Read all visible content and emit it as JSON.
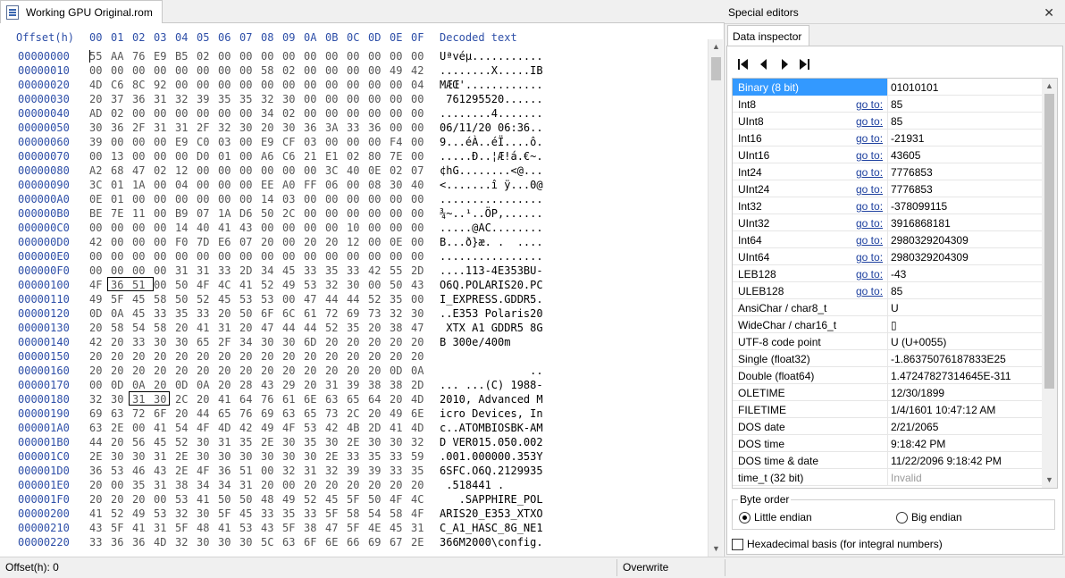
{
  "tab": {
    "filename": "Working GPU Original.rom"
  },
  "hex_header": {
    "offset_label": "Offset(h)",
    "columns": [
      "00",
      "01",
      "02",
      "03",
      "04",
      "05",
      "06",
      "07",
      "08",
      "09",
      "0A",
      "0B",
      "0C",
      "0D",
      "0E",
      "0F"
    ],
    "decoded_label": "Decoded text"
  },
  "rows": [
    {
      "offset": "00000000",
      "bytes": [
        "55",
        "AA",
        "76",
        "E9",
        "B5",
        "02",
        "00",
        "00",
        "00",
        "00",
        "00",
        "00",
        "00",
        "00",
        "00",
        "00"
      ],
      "text": "Uªvéµ..........."
    },
    {
      "offset": "00000010",
      "bytes": [
        "00",
        "00",
        "00",
        "00",
        "00",
        "00",
        "00",
        "00",
        "58",
        "02",
        "00",
        "00",
        "00",
        "00",
        "49",
        "42"
      ],
      "text": "........X.....IB"
    },
    {
      "offset": "00000020",
      "bytes": [
        "4D",
        "C6",
        "8C",
        "92",
        "00",
        "00",
        "00",
        "00",
        "00",
        "00",
        "00",
        "00",
        "00",
        "00",
        "00",
        "04"
      ],
      "text": "MÆŒ'............"
    },
    {
      "offset": "00000030",
      "bytes": [
        "20",
        "37",
        "36",
        "31",
        "32",
        "39",
        "35",
        "35",
        "32",
        "30",
        "00",
        "00",
        "00",
        "00",
        "00",
        "00"
      ],
      "text": " 761295520......"
    },
    {
      "offset": "00000040",
      "bytes": [
        "AD",
        "02",
        "00",
        "00",
        "00",
        "00",
        "00",
        "00",
        "34",
        "02",
        "00",
        "00",
        "00",
        "00",
        "00",
        "00"
      ],
      "text": "........4......."
    },
    {
      "offset": "00000050",
      "bytes": [
        "30",
        "36",
        "2F",
        "31",
        "31",
        "2F",
        "32",
        "30",
        "20",
        "30",
        "36",
        "3A",
        "33",
        "36",
        "00",
        "00"
      ],
      "text": "06/11/20 06:36.."
    },
    {
      "offset": "00000060",
      "bytes": [
        "39",
        "00",
        "00",
        "00",
        "E9",
        "C0",
        "03",
        "00",
        "E9",
        "CF",
        "03",
        "00",
        "00",
        "00",
        "F4",
        "00"
      ],
      "text": "9...éÀ..éÏ....ô."
    },
    {
      "offset": "00000070",
      "bytes": [
        "00",
        "13",
        "00",
        "00",
        "00",
        "D0",
        "01",
        "00",
        "A6",
        "C6",
        "21",
        "E1",
        "02",
        "80",
        "7E",
        "00"
      ],
      "text": ".....Ð..¦Æ!á.€~."
    },
    {
      "offset": "00000080",
      "bytes": [
        "A2",
        "68",
        "47",
        "02",
        "12",
        "00",
        "00",
        "00",
        "00",
        "00",
        "00",
        "3C",
        "40",
        "0E",
        "02",
        "07"
      ],
      "text": "¢hG........<@..."
    },
    {
      "offset": "00000090",
      "bytes": [
        "3C",
        "01",
        "1A",
        "00",
        "04",
        "00",
        "00",
        "00",
        "EE",
        "A0",
        "FF",
        "06",
        "00",
        "08",
        "30",
        "40"
      ],
      "text": "<.......î ÿ...0@"
    },
    {
      "offset": "000000A0",
      "bytes": [
        "0E",
        "01",
        "00",
        "00",
        "00",
        "00",
        "00",
        "00",
        "14",
        "03",
        "00",
        "00",
        "00",
        "00",
        "00",
        "00"
      ],
      "text": "................"
    },
    {
      "offset": "000000B0",
      "bytes": [
        "BE",
        "7E",
        "11",
        "00",
        "B9",
        "07",
        "1A",
        "D6",
        "50",
        "2C",
        "00",
        "00",
        "00",
        "00",
        "00",
        "00"
      ],
      "text": "¾~..¹..ÖP,......"
    },
    {
      "offset": "000000C0",
      "bytes": [
        "00",
        "00",
        "00",
        "00",
        "14",
        "40",
        "41",
        "43",
        "00",
        "00",
        "00",
        "00",
        "10",
        "00",
        "00",
        "00"
      ],
      "text": ".....@AC........"
    },
    {
      "offset": "000000D0",
      "bytes": [
        "42",
        "00",
        "00",
        "00",
        "F0",
        "7D",
        "E6",
        "07",
        "20",
        "00",
        "20",
        "20",
        "12",
        "00",
        "0E",
        "00"
      ],
      "text": "B...ð}æ. .  ...."
    },
    {
      "offset": "000000E0",
      "bytes": [
        "00",
        "00",
        "00",
        "00",
        "00",
        "00",
        "00",
        "00",
        "00",
        "00",
        "00",
        "00",
        "00",
        "00",
        "00",
        "00"
      ],
      "text": "................"
    },
    {
      "offset": "000000F0",
      "bytes": [
        "00",
        "00",
        "00",
        "00",
        "31",
        "31",
        "33",
        "2D",
        "34",
        "45",
        "33",
        "35",
        "33",
        "42",
        "55",
        "2D"
      ],
      "text": "....113-4E353BU-"
    },
    {
      "offset": "00000100",
      "bytes": [
        "4F",
        "36",
        "51",
        "00",
        "50",
        "4F",
        "4C",
        "41",
        "52",
        "49",
        "53",
        "32",
        "30",
        "00",
        "50",
        "43"
      ],
      "text": "O6Q.POLARIS20.PC"
    },
    {
      "offset": "00000110",
      "bytes": [
        "49",
        "5F",
        "45",
        "58",
        "50",
        "52",
        "45",
        "53",
        "53",
        "00",
        "47",
        "44",
        "44",
        "52",
        "35",
        "00"
      ],
      "text": "I_EXPRESS.GDDR5."
    },
    {
      "offset": "00000120",
      "bytes": [
        "0D",
        "0A",
        "45",
        "33",
        "35",
        "33",
        "20",
        "50",
        "6F",
        "6C",
        "61",
        "72",
        "69",
        "73",
        "32",
        "30"
      ],
      "text": "..E353 Polaris20"
    },
    {
      "offset": "00000130",
      "bytes": [
        "20",
        "58",
        "54",
        "58",
        "20",
        "41",
        "31",
        "20",
        "47",
        "44",
        "44",
        "52",
        "35",
        "20",
        "38",
        "47"
      ],
      "text": " XTX A1 GDDR5 8G"
    },
    {
      "offset": "00000140",
      "bytes": [
        "42",
        "20",
        "33",
        "30",
        "30",
        "65",
        "2F",
        "34",
        "30",
        "30",
        "6D",
        "20",
        "20",
        "20",
        "20",
        "20"
      ],
      "text": "B 300e/400m     "
    },
    {
      "offset": "00000150",
      "bytes": [
        "20",
        "20",
        "20",
        "20",
        "20",
        "20",
        "20",
        "20",
        "20",
        "20",
        "20",
        "20",
        "20",
        "20",
        "20",
        "20"
      ],
      "text": "                "
    },
    {
      "offset": "00000160",
      "bytes": [
        "20",
        "20",
        "20",
        "20",
        "20",
        "20",
        "20",
        "20",
        "20",
        "20",
        "20",
        "20",
        "20",
        "20",
        "0D",
        "0A"
      ],
      "text": "              .."
    },
    {
      "offset": "00000170",
      "bytes": [
        "00",
        "0D",
        "0A",
        "20",
        "0D",
        "0A",
        "20",
        "28",
        "43",
        "29",
        "20",
        "31",
        "39",
        "38",
        "38",
        "2D"
      ],
      "text": "... ...(C) 1988-"
    },
    {
      "offset": "00000180",
      "bytes": [
        "32",
        "30",
        "31",
        "30",
        "2C",
        "20",
        "41",
        "64",
        "76",
        "61",
        "6E",
        "63",
        "65",
        "64",
        "20",
        "4D"
      ],
      "text": "2010, Advanced M"
    },
    {
      "offset": "00000190",
      "bytes": [
        "69",
        "63",
        "72",
        "6F",
        "20",
        "44",
        "65",
        "76",
        "69",
        "63",
        "65",
        "73",
        "2C",
        "20",
        "49",
        "6E"
      ],
      "text": "icro Devices, In"
    },
    {
      "offset": "000001A0",
      "bytes": [
        "63",
        "2E",
        "00",
        "41",
        "54",
        "4F",
        "4D",
        "42",
        "49",
        "4F",
        "53",
        "42",
        "4B",
        "2D",
        "41",
        "4D"
      ],
      "text": "c..ATOMBIOSBK-AM"
    },
    {
      "offset": "000001B0",
      "bytes": [
        "44",
        "20",
        "56",
        "45",
        "52",
        "30",
        "31",
        "35",
        "2E",
        "30",
        "35",
        "30",
        "2E",
        "30",
        "30",
        "32"
      ],
      "text": "D VER015.050.002"
    },
    {
      "offset": "000001C0",
      "bytes": [
        "2E",
        "30",
        "30",
        "31",
        "2E",
        "30",
        "30",
        "30",
        "30",
        "30",
        "30",
        "2E",
        "33",
        "35",
        "33",
        "59"
      ],
      "text": ".001.000000.353Y"
    },
    {
      "offset": "000001D0",
      "bytes": [
        "36",
        "53",
        "46",
        "43",
        "2E",
        "4F",
        "36",
        "51",
        "00",
        "32",
        "31",
        "32",
        "39",
        "39",
        "33",
        "35"
      ],
      "text": "6SFC.O6Q.2129935"
    },
    {
      "offset": "000001E0",
      "bytes": [
        "20",
        "00",
        "35",
        "31",
        "38",
        "34",
        "34",
        "31",
        "20",
        "00",
        "20",
        "20",
        "20",
        "20",
        "20",
        "20"
      ],
      "text": " .518441 .      "
    },
    {
      "offset": "000001F0",
      "bytes": [
        "20",
        "20",
        "20",
        "00",
        "53",
        "41",
        "50",
        "50",
        "48",
        "49",
        "52",
        "45",
        "5F",
        "50",
        "4F",
        "4C"
      ],
      "text": "   .SAPPHIRE_POL"
    },
    {
      "offset": "00000200",
      "bytes": [
        "41",
        "52",
        "49",
        "53",
        "32",
        "30",
        "5F",
        "45",
        "33",
        "35",
        "33",
        "5F",
        "58",
        "54",
        "58",
        "4F"
      ],
      "text": "ARIS20_E353_XTXO"
    },
    {
      "offset": "00000210",
      "bytes": [
        "43",
        "5F",
        "41",
        "31",
        "5F",
        "48",
        "41",
        "53",
        "43",
        "5F",
        "38",
        "47",
        "5F",
        "4E",
        "45",
        "31"
      ],
      "text": "C_A1_HASC_8G_NE1"
    },
    {
      "offset": "00000220",
      "bytes": [
        "33",
        "36",
        "36",
        "4D",
        "32",
        "30",
        "30",
        "30",
        "5C",
        "63",
        "6F",
        "6E",
        "66",
        "69",
        "67",
        "2E"
      ],
      "text": "366M2000\\config."
    }
  ],
  "special_editors": {
    "title": "Special editors",
    "close_symbol": "✕",
    "inspector_tab": "Data inspector",
    "goto_label": "go to:",
    "fields": [
      {
        "name": "Binary (8 bit)",
        "goto": false,
        "value": "01010101",
        "selected": true
      },
      {
        "name": "Int8",
        "goto": true,
        "value": "85"
      },
      {
        "name": "UInt8",
        "goto": true,
        "value": "85"
      },
      {
        "name": "Int16",
        "goto": true,
        "value": "-21931"
      },
      {
        "name": "UInt16",
        "goto": true,
        "value": "43605"
      },
      {
        "name": "Int24",
        "goto": true,
        "value": "7776853"
      },
      {
        "name": "UInt24",
        "goto": true,
        "value": "7776853"
      },
      {
        "name": "Int32",
        "goto": true,
        "value": "-378099115"
      },
      {
        "name": "UInt32",
        "goto": true,
        "value": "3916868181"
      },
      {
        "name": "Int64",
        "goto": true,
        "value": "2980329204309"
      },
      {
        "name": "UInt64",
        "goto": true,
        "value": "2980329204309"
      },
      {
        "name": "LEB128",
        "goto": true,
        "value": "-43"
      },
      {
        "name": "ULEB128",
        "goto": true,
        "value": "85"
      },
      {
        "name": "AnsiChar / char8_t",
        "goto": false,
        "value": "U"
      },
      {
        "name": "WideChar / char16_t",
        "goto": false,
        "value": "▯"
      },
      {
        "name": "UTF-8 code point",
        "goto": false,
        "value": "U (U+0055)"
      },
      {
        "name": "Single (float32)",
        "goto": false,
        "value": "-1.86375076187833E25"
      },
      {
        "name": "Double (float64)",
        "goto": false,
        "value": "1.47247827314645E-311"
      },
      {
        "name": "OLETIME",
        "goto": false,
        "value": "12/30/1899"
      },
      {
        "name": "FILETIME",
        "goto": false,
        "value": "1/4/1601 10:47:12 AM"
      },
      {
        "name": "DOS date",
        "goto": false,
        "value": "2/21/2065"
      },
      {
        "name": "DOS time",
        "goto": false,
        "value": "9:18:42 PM"
      },
      {
        "name": "DOS time & date",
        "goto": false,
        "value": "11/22/2096 9:18:42 PM"
      },
      {
        "name": "time_t (32 bit)",
        "goto": false,
        "value": "Invalid",
        "invalid": true
      }
    ],
    "byte_order": {
      "legend": "Byte order",
      "little": "Little endian",
      "big": "Big endian",
      "selected": "little"
    },
    "hex_basis_label": "Hexadecimal basis (for integral numbers)"
  },
  "status": {
    "offset": "Offset(h): 0",
    "mode": "Overwrite"
  }
}
